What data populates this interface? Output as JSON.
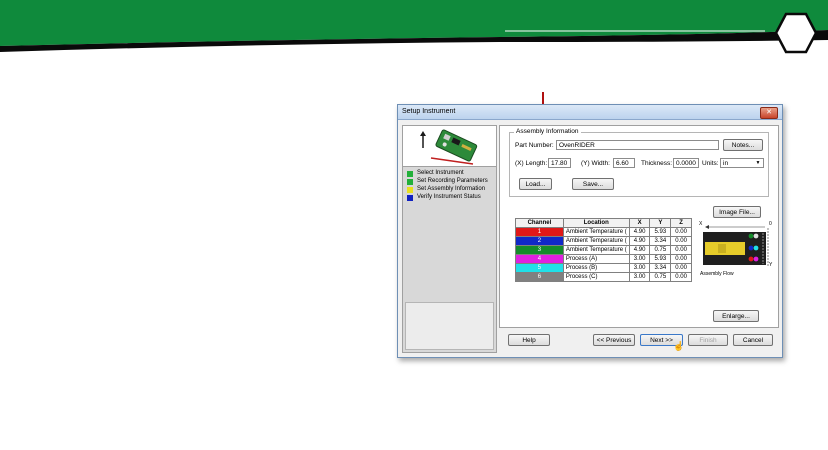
{
  "colors": {
    "banner_green": "#0f8a3c",
    "accent_red": "#b01010",
    "dialog_border": "#6e8fb5"
  },
  "dialog": {
    "title": "Setup Instrument",
    "close_icon": "close-icon"
  },
  "steps": [
    {
      "label": "Select Instrument",
      "color": "#22b03a"
    },
    {
      "label": "Set Recording Parameters",
      "color": "#22b03a"
    },
    {
      "label": "Set Assembly Information",
      "color": "#e8e020"
    },
    {
      "label": "Verify Instrument Status",
      "color": "#1020c0"
    }
  ],
  "assembly": {
    "legend": "Assembly Information",
    "part_number_label": "Part Number:",
    "part_number_value": "OvenRIDER",
    "notes_button": "Notes...",
    "length_label": "(X) Length:",
    "length_value": "17.80",
    "width_label": "(Y) Width:",
    "width_value": "6.60",
    "thickness_label": "Thickness:",
    "thickness_value": "0.0000",
    "units_label": "Units:",
    "units_value": "in",
    "load_button": "Load...",
    "save_button": "Save..."
  },
  "table": {
    "headers": [
      "Channel",
      "Location",
      "X",
      "Y",
      "Z"
    ],
    "rows": [
      {
        "channel": "1",
        "color": "#e01818",
        "location": "Ambient Temperature (",
        "x": "4.90",
        "y": "5.93",
        "z": "0.00"
      },
      {
        "channel": "2",
        "color": "#1028c8",
        "location": "Ambient Temperature (",
        "x": "4.90",
        "y": "3.34",
        "z": "0.00"
      },
      {
        "channel": "3",
        "color": "#148c2a",
        "location": "Ambient Temperature (",
        "x": "4.90",
        "y": "0.75",
        "z": "0.00"
      },
      {
        "channel": "4",
        "color": "#e020e0",
        "location": "Process (A)",
        "x": "3.00",
        "y": "5.93",
        "z": "0.00"
      },
      {
        "channel": "5",
        "color": "#20e0e8",
        "location": "Process (B)",
        "x": "3.00",
        "y": "3.34",
        "z": "0.00"
      },
      {
        "channel": "6",
        "color": "#808080",
        "location": "Process (C)",
        "x": "3.00",
        "y": "0.75",
        "z": "0.00"
      }
    ]
  },
  "assembly_image": {
    "image_file_button": "Image File...",
    "x_label": "X",
    "y_label": "Y",
    "zero_label": "0",
    "caption": "Assembly Flow",
    "enlarge_button": "Enlarge..."
  },
  "bottom_buttons": {
    "help": "Help",
    "previous": "<< Previous",
    "next": "Next >>",
    "finish": "Finish",
    "cancel": "Cancel"
  }
}
